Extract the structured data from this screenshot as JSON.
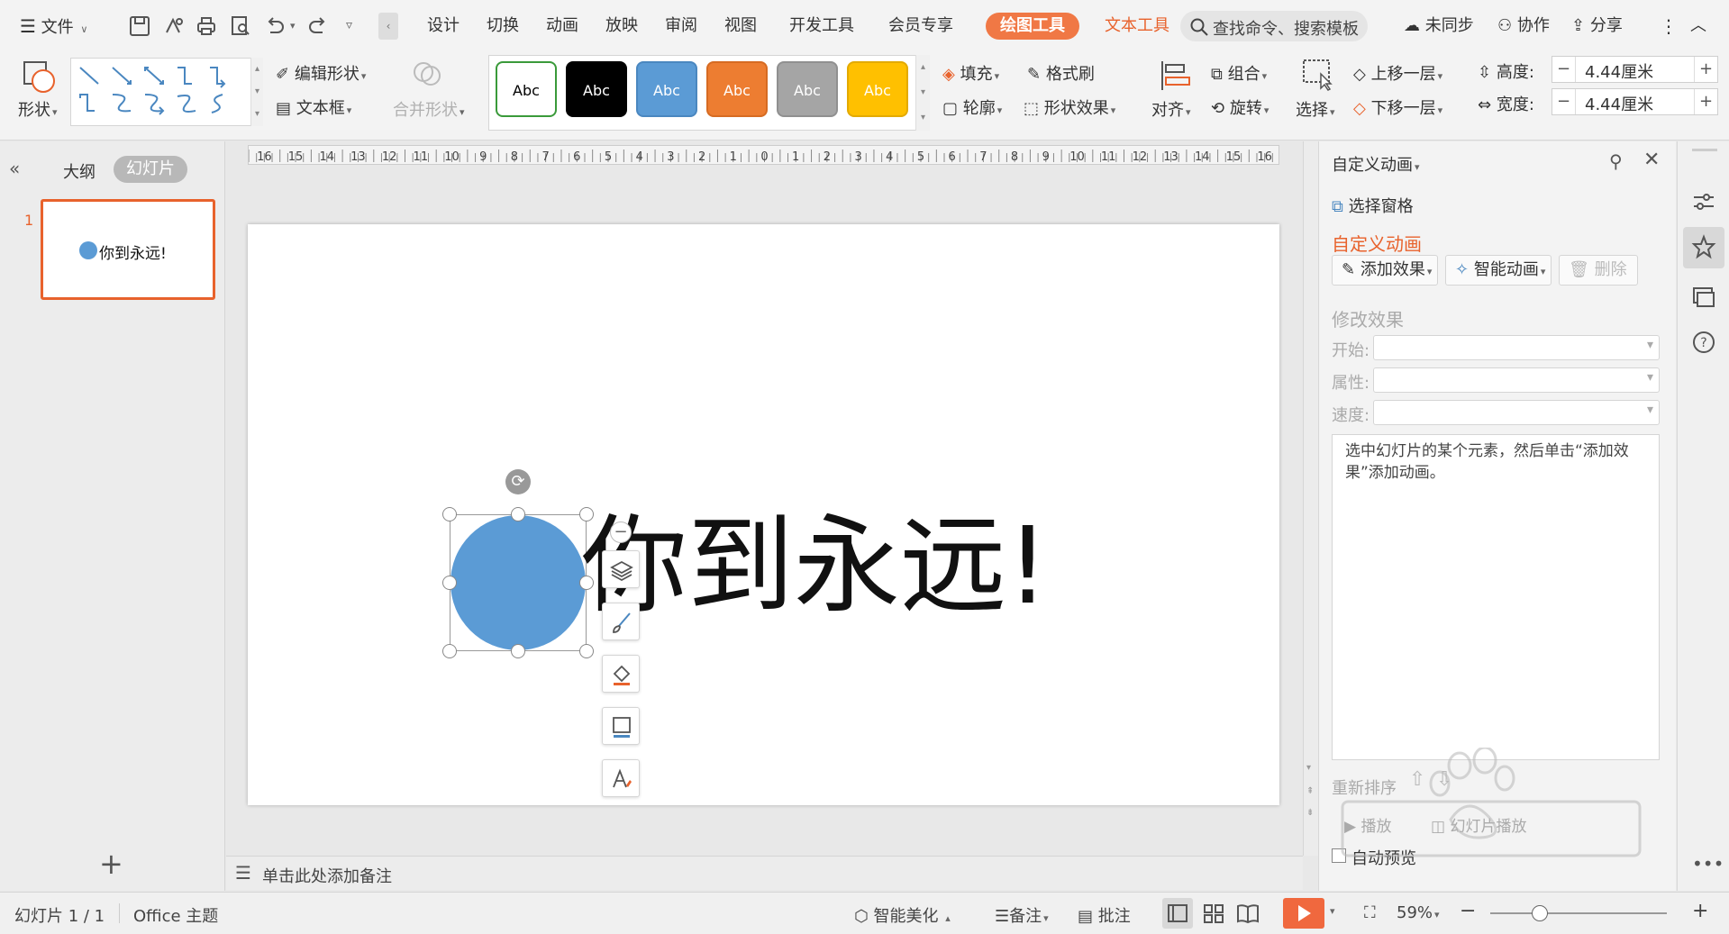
{
  "menu": {
    "file_label": "文件",
    "tabs": [
      "设计",
      "切换",
      "动画",
      "放映",
      "审阅",
      "视图",
      "开发工具",
      "会员专享"
    ],
    "active_tab": "绘图工具",
    "text_tools_tab": "文本工具",
    "search_placeholder": "查找命令、搜索模板",
    "sync_label": "未同步",
    "collab_label": "协作",
    "share_label": "分享"
  },
  "ribbon": {
    "shape_label": "形状",
    "edit_shape_label": "编辑形状",
    "textbox_label": "文本框",
    "merge_shape_label": "合并形状",
    "style_swatches": [
      {
        "label": "Abc",
        "fill": "#ffffff",
        "border": "#3a9a3a",
        "text": "#000000"
      },
      {
        "label": "Abc",
        "fill": "#000000",
        "border": "#000000",
        "text": "#ffffff"
      },
      {
        "label": "Abc",
        "fill": "#5b9bd5",
        "border": "#4a87c0",
        "text": "#ffffff"
      },
      {
        "label": "Abc",
        "fill": "#ed7d31",
        "border": "#d66b22",
        "text": "#ffffff"
      },
      {
        "label": "Abc",
        "fill": "#a5a5a5",
        "border": "#909090",
        "text": "#ffffff"
      },
      {
        "label": "Abc",
        "fill": "#ffc000",
        "border": "#e3aa00",
        "text": "#ffffff"
      }
    ],
    "fill_label": "填充",
    "format_painter_label": "格式刷",
    "outline_label": "轮廓",
    "shape_effects_label": "形状效果",
    "align_label": "对齐",
    "group_label": "组合",
    "rotate_label": "旋转",
    "select_label": "选择",
    "bring_forward_label": "上移一层",
    "send_backward_label": "下移一层",
    "height_label": "高度:",
    "height_value": "4.44厘米",
    "width_label": "宽度:",
    "width_value": "4.44厘米"
  },
  "left_panel": {
    "outline_tab": "大纲",
    "slides_tab": "幻灯片",
    "slide_number": "1",
    "thumb_text": "你到永远!"
  },
  "ruler_labels": [
    "16",
    "15",
    "14",
    "13",
    "12",
    "11",
    "10",
    "9",
    "8",
    "7",
    "6",
    "5",
    "4",
    "3",
    "2",
    "1",
    "0",
    "1",
    "2",
    "3",
    "4",
    "5",
    "6",
    "7",
    "8",
    "9",
    "10",
    "11",
    "12",
    "13",
    "14",
    "15",
    "16"
  ],
  "slide": {
    "text": "你到永远!",
    "circle_color": "#5b9bd5"
  },
  "notes": {
    "placeholder": "单击此处添加备注"
  },
  "task_pane": {
    "title": "自定义动画",
    "selection_pane": "选择窗格",
    "section_title": "自定义动画",
    "add_effect": "添加效果",
    "smart_animation": "智能动画",
    "delete": "删除",
    "modify_effect": "修改效果",
    "start_label": "开始:",
    "property_label": "属性:",
    "speed_label": "速度:",
    "hint": "选中幻灯片的某个元素，然后单击“添加效果”添加动画。",
    "reorder_label": "重新排序",
    "play_label": "播放",
    "slideshow_label": "幻灯片播放",
    "auto_preview": "自动预览"
  },
  "status": {
    "slide_indicator": "幻灯片 1 / 1",
    "theme": "Office 主题",
    "smart_beautify": "智能美化",
    "notes_label": "备注",
    "comments_label": "批注",
    "zoom": "59%"
  },
  "colors": {
    "accent": "#e8622c",
    "active_tab": "#f07845"
  }
}
